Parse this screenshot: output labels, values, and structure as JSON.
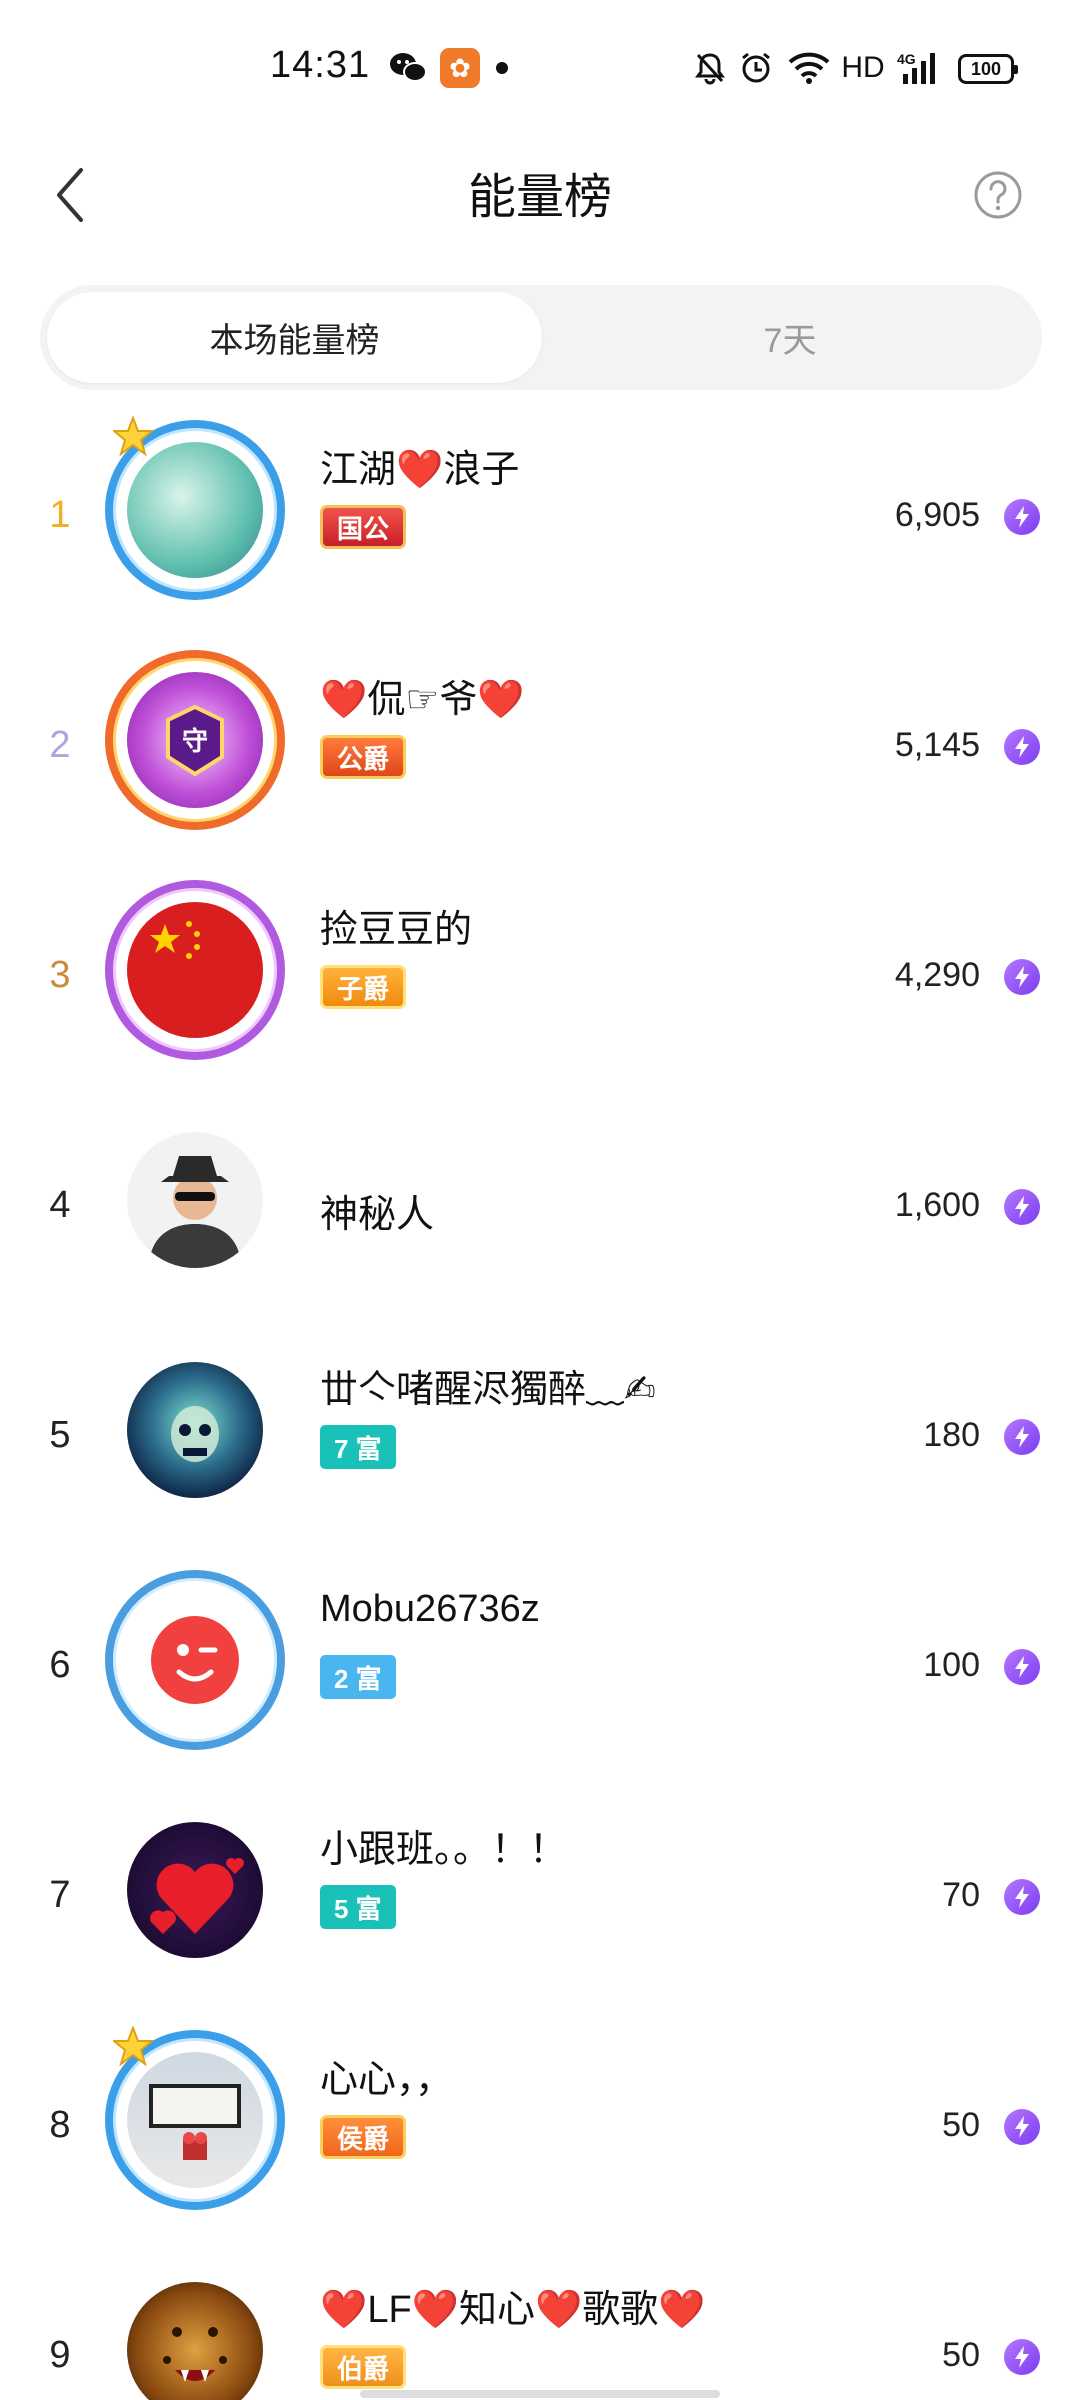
{
  "status_bar": {
    "time": "14:31",
    "hd": "HD",
    "network": "4G",
    "battery": "100"
  },
  "header": {
    "title": "能量榜"
  },
  "tabs": [
    {
      "label": "本场能量榜",
      "active": true
    },
    {
      "label": "7天",
      "active": false
    }
  ],
  "ranking": [
    {
      "rank": "1",
      "name": "江湖❤️浪子",
      "badge": "国公",
      "badge_type": "guogong",
      "score": "6,905"
    },
    {
      "rank": "2",
      "name": "❤️侃☞爷❤️",
      "badge": "公爵",
      "badge_type": "gongjue",
      "score": "5,145"
    },
    {
      "rank": "3",
      "name": "捡豆豆的",
      "badge": "子爵",
      "badge_type": "zijue",
      "score": "4,290"
    },
    {
      "rank": "4",
      "name": "神秘人",
      "badge": "",
      "badge_type": "",
      "score": "1,600"
    },
    {
      "rank": "5",
      "name": "丗亽啫醒浕獨醉﹏✍",
      "badge": "7 富",
      "badge_type": "fu7",
      "score": "180"
    },
    {
      "rank": "6",
      "name": "Mobu26736z",
      "badge": "2 富",
      "badge_type": "fu2",
      "score": "100"
    },
    {
      "rank": "7",
      "name": "小跟班。。！！",
      "badge": "5 富",
      "badge_type": "fu5",
      "score": "70"
    },
    {
      "rank": "8",
      "name": "心心，，",
      "badge": "侯爵",
      "badge_type": "houjue",
      "score": "50"
    },
    {
      "rank": "9",
      "name": "❤️LF❤️知心❤️歌歌❤️",
      "badge": "伯爵",
      "badge_type": "bojue",
      "score": "50"
    }
  ],
  "colors": {
    "rank1": "#f0b020",
    "rank2": "#a8a6dc",
    "rank3": "#c98c3c",
    "energy": "#8a4cf5",
    "tab_inactive_text": "#9a9a9a"
  },
  "icons": {
    "back": "chevron-left-icon",
    "help": "question-circle-icon",
    "energy": "lightning-icon"
  }
}
